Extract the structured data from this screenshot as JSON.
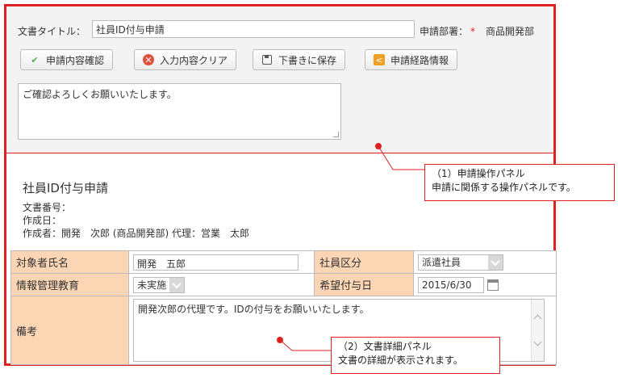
{
  "panel_request": {
    "title_label": "文書タイトル：",
    "title_value": "社員ID付与申請",
    "dept_label": "申請部署：",
    "dept_required": "*",
    "dept_value": "商品開発部",
    "buttons": {
      "confirm": "申請内容確認",
      "clear": "入力内容クリア",
      "draft": "下書きに保存",
      "route": "申請経路情報"
    },
    "memo": "ご確認よろしくお願いいたします。"
  },
  "panel_detail": {
    "doc_title": "社員ID付与申請",
    "doc_number": "文書番号：",
    "created_date": "作成日：",
    "creator": "作成者：開発　次郎 (商品開発部) 代理：営業　太郎",
    "rows": {
      "target_name_label": "対象者氏名",
      "target_name_value": "開発　五郎",
      "employee_type_label": "社員区分",
      "employee_type_value": "派遣社員",
      "info_education_label": "情報管理教育",
      "info_education_value": "未実施",
      "desired_date_label": "希望付与日",
      "desired_date_value": "2015/6/30",
      "remarks_label": "備考",
      "remarks_value": "開発次郎の代理です。IDの付与をお願いいたします。"
    }
  },
  "callouts": {
    "one_title": "（1）申請操作パネル",
    "one_desc": "申請に関係する操作パネルです。",
    "two_title": "（2）文書詳細パネル",
    "two_desc": "文書の詳細が表示されます。"
  },
  "colors": {
    "frame": "#e02020",
    "label_bg": "#fcd5b4",
    "panel_bg": "#f3f3f3"
  }
}
